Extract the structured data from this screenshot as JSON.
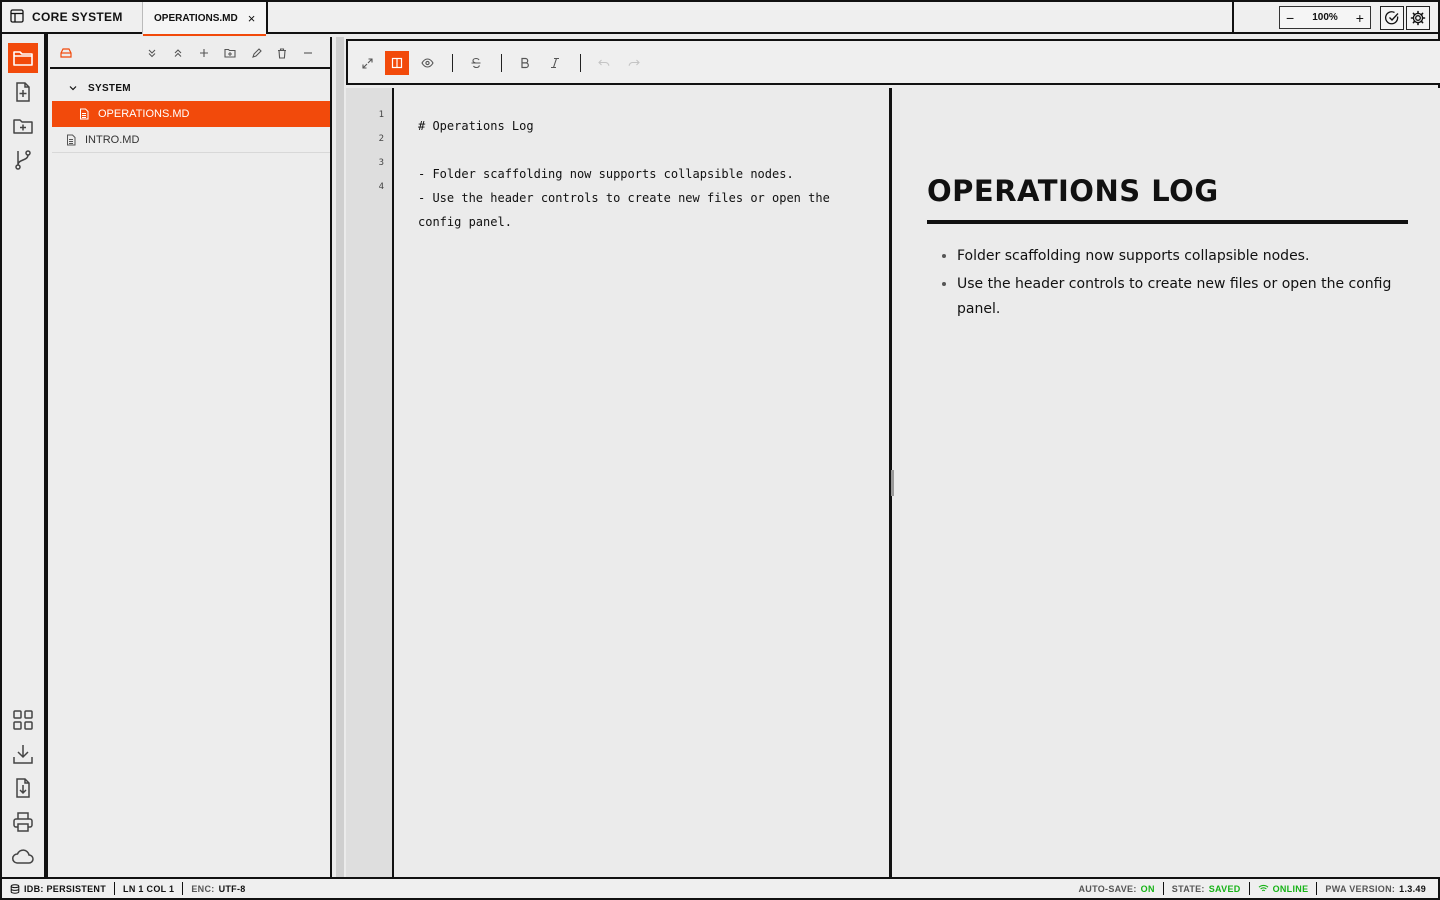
{
  "app": {
    "title": "CORE SYSTEM"
  },
  "tabs": [
    {
      "label": "OPERATIONS.MD",
      "close": "×"
    }
  ],
  "zoom": {
    "value": "100%",
    "minus": "−",
    "plus": "+"
  },
  "sidebar": {
    "tree": [
      {
        "type": "folder",
        "label": "SYSTEM",
        "expanded": true
      },
      {
        "type": "file",
        "label": "OPERATIONS.MD",
        "active": true
      },
      {
        "type": "file",
        "label": "INTRO.MD",
        "active": false
      }
    ]
  },
  "editor": {
    "line_numbers": [
      "1",
      "2",
      "3",
      "4"
    ],
    "lines": [
      "# Operations Log",
      "",
      "- Folder scaffolding now supports collapsible nodes.",
      "- Use the header controls to create new files or open the config panel."
    ]
  },
  "preview": {
    "heading": "OPERATIONS LOG",
    "items": [
      "Folder scaffolding now supports collapsible nodes.",
      "Use the header controls to create new files or open the config panel."
    ]
  },
  "status": {
    "idb": "IDB: PERSISTENT",
    "position": "LN 1 COL 1",
    "enc_label": "ENC:",
    "enc_value": "UTF-8",
    "autosave_label": "AUTO-SAVE:",
    "autosave_value": "ON",
    "state_label": "STATE:",
    "state_value": "SAVED",
    "online": "ONLINE",
    "version_label": "PWA VERSION:",
    "version_value": "1.3.49"
  },
  "colors": {
    "accent": "#f24a0b",
    "ok": "#17b317",
    "ink": "#111111"
  }
}
